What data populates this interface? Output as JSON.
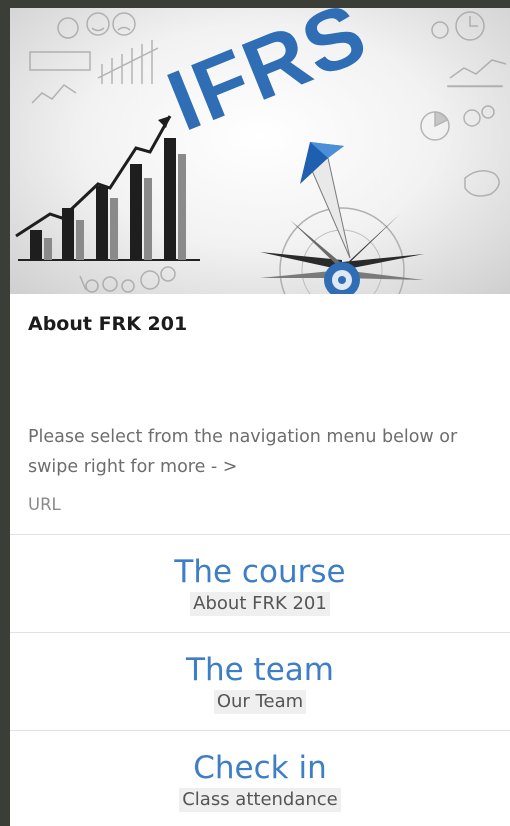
{
  "hero": {
    "image_title": "IFRS",
    "accent_color": "#2f6db5"
  },
  "course": {
    "title": "About FRK 201",
    "instructions": "Please select from the navigation menu below or swipe right for more - >",
    "url_label": "URL"
  },
  "nav": {
    "items": [
      {
        "title": "The course",
        "subtitle": "About FRK 201"
      },
      {
        "title": "The team",
        "subtitle": "Our Team"
      },
      {
        "title": "Check in",
        "subtitle": "Class attendance"
      }
    ]
  }
}
